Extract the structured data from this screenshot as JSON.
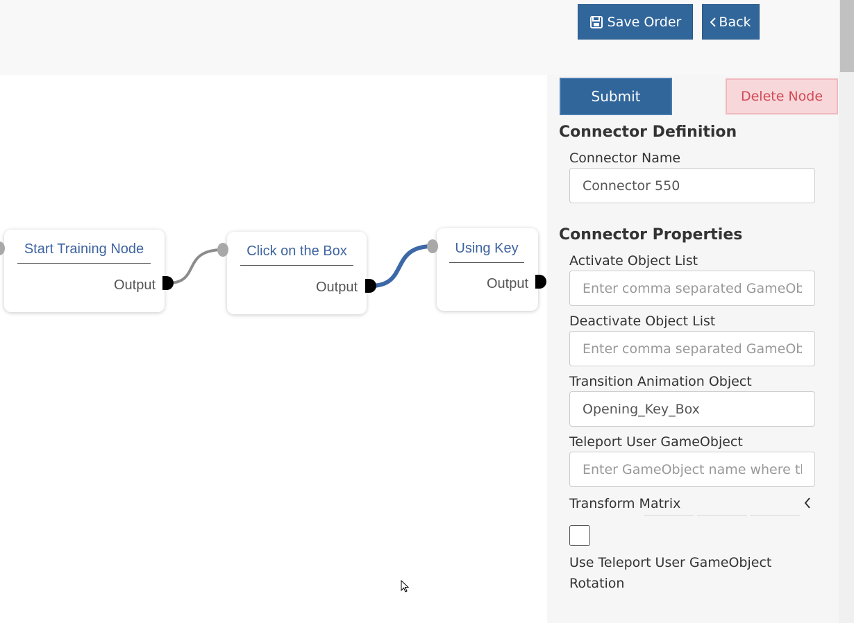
{
  "toolbar": {
    "save_label": "Save Order",
    "back_label": "Back",
    "save_icon": "floppy-disk-icon",
    "back_icon": "chevron-left-icon"
  },
  "graph": {
    "nodes": [
      {
        "title": "Start Training Node",
        "output": "Output"
      },
      {
        "title": "Click on the Box",
        "output": "Output"
      },
      {
        "title": "Using Key",
        "output": "Output"
      }
    ],
    "active_wire_color": "#3d68a8",
    "idle_wire_color": "#8c8c8c"
  },
  "panel": {
    "submit_label": "Submit",
    "delete_label": "Delete Node",
    "definition_title": "Connector Definition",
    "connector_name_label": "Connector Name",
    "connector_name_value": "Connector 550",
    "properties_title": "Connector Properties",
    "activate_label": "Activate Object List",
    "activate_placeholder": "Enter comma separated GameObject names",
    "deactivate_label": "Deactivate Object List",
    "deactivate_placeholder": "Enter comma separated GameObject names",
    "transition_label": "Transition Animation Object",
    "transition_value": "Opening_Key_Box",
    "teleport_label": "Teleport User GameObject",
    "teleport_placeholder": "Enter GameObject name where the user teleports",
    "matrix_label": "Transform Matrix",
    "teleport_rotation_label": "Use Teleport User GameObject Rotation",
    "teleport_rotation_checked": false
  },
  "colors": {
    "primary": "#31669b",
    "danger_bg": "#f8d7da",
    "danger_text": "#d14a55",
    "node_title": "#3d63a0"
  }
}
